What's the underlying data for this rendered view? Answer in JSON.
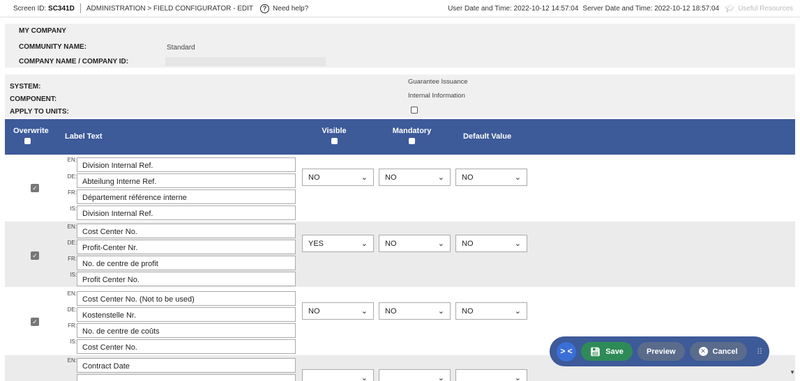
{
  "topbar": {
    "screen_id_label": "Screen ID:",
    "screen_id": "SC341D",
    "breadcrumb": "ADMINISTRATION > FIELD CONFIGURATOR - EDIT",
    "help": "Need help?",
    "user_datetime": "User Date and Time: 2022-10-12 14:57:04",
    "server_datetime": "Server Date and Time: 2022-10-12 18:57:04",
    "useful_resources": "Useful Resources"
  },
  "company": {
    "title": "MY COMPANY",
    "community_label": "COMMUNITY NAME:",
    "community_value": "Standard",
    "company_label": "COMPANY NAME / COMPANY ID:"
  },
  "system": {
    "system_label": "SYSTEM:",
    "system_value": "Guarantee Issuance",
    "component_label": "COMPONENT:",
    "component_value": "Internal Information",
    "apply_label": "APPLY TO UNITS:"
  },
  "table_header": {
    "overwrite": "Overwrite",
    "label_text": "Label Text",
    "visible": "Visible",
    "mandatory": "Mandatory",
    "default_value": "Default Value"
  },
  "rows": [
    {
      "labels": {
        "en": "Division Internal Ref.",
        "de": "Abteilung Interne Ref.",
        "fr": "Département référence interne",
        "is": "Division Internal Ref."
      },
      "visible": "NO",
      "mandatory": "NO",
      "default": "NO"
    },
    {
      "labels": {
        "en": "Cost Center No.",
        "de": "Profit-Center Nr.",
        "fr": "No. de centre de profit",
        "is": "Profit Center No."
      },
      "visible": "YES",
      "mandatory": "NO",
      "default": "NO"
    },
    {
      "labels": {
        "en": "Cost Center No. (Not to be used)",
        "de": "Kostenstelle Nr.",
        "fr": "No. de centre de coûts",
        "is": "Cost Center No."
      },
      "visible": "NO",
      "mandatory": "NO",
      "default": "NO"
    },
    {
      "labels": {
        "en": "Contract Date"
      }
    }
  ],
  "lang_codes": {
    "en": "EN:",
    "de": "DE:",
    "fr": "FR:",
    "is": "IS:"
  },
  "actions": {
    "save": "Save",
    "preview": "Preview",
    "cancel": "Cancel"
  },
  "colors": {
    "header_bg": "#3d5a99",
    "save_bg": "#2e8b57",
    "accent": "#3a6fd8"
  }
}
